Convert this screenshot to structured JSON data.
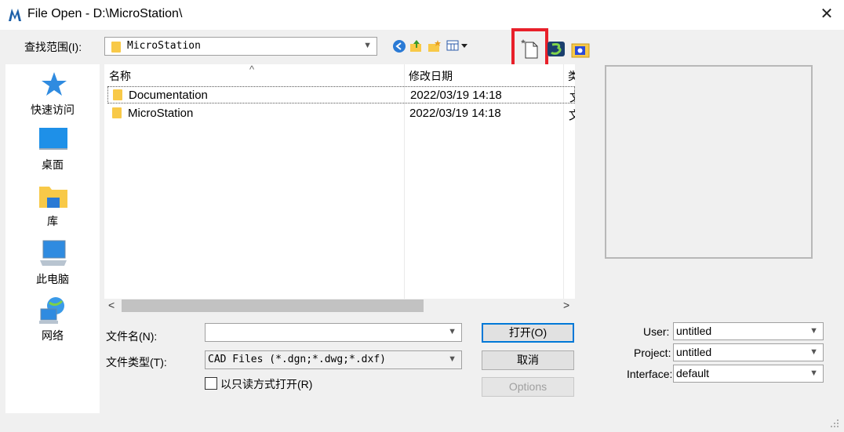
{
  "window": {
    "title": "File Open - D:\\MicroStation\\",
    "close_glyph": "✕"
  },
  "lookin": {
    "label": "查找范围(I):",
    "value": "MicroStation"
  },
  "sidebar": {
    "items": [
      {
        "label": "快速访问",
        "icon": "star-icon"
      },
      {
        "label": "桌面",
        "icon": "desktop-icon"
      },
      {
        "label": "库",
        "icon": "library-folder-icon"
      },
      {
        "label": "此电脑",
        "icon": "computer-icon"
      },
      {
        "label": "网络",
        "icon": "network-icon"
      }
    ]
  },
  "filelist": {
    "columns": [
      "名称",
      "修改日期",
      "类"
    ],
    "sort_glyph": "^",
    "rows": [
      {
        "name": "Documentation",
        "modified": "2022/03/19 14:18",
        "type": "文"
      },
      {
        "name": "MicroStation",
        "modified": "2022/03/19 14:18",
        "type": "文"
      }
    ]
  },
  "scroll": {
    "left": "<",
    "right": ">"
  },
  "filename": {
    "label": "文件名(N):",
    "value": ""
  },
  "filetype": {
    "label": "文件类型(T):",
    "value": "CAD Files (*.dgn;*.dwg;*.dxf)"
  },
  "readonly": {
    "label": "以只读方式打开(R)",
    "checked": false
  },
  "buttons": {
    "open": "打开(O)",
    "cancel": "取消",
    "options": "Options"
  },
  "workspace": {
    "user_label": "User:",
    "user_value": "untitled",
    "project_label": "Project:",
    "project_value": "untitled",
    "interface_label": "Interface:",
    "interface_value": "default"
  },
  "colors": {
    "highlight": "#e8202a",
    "folder": "#f8c948",
    "accent": "#0078d7"
  }
}
